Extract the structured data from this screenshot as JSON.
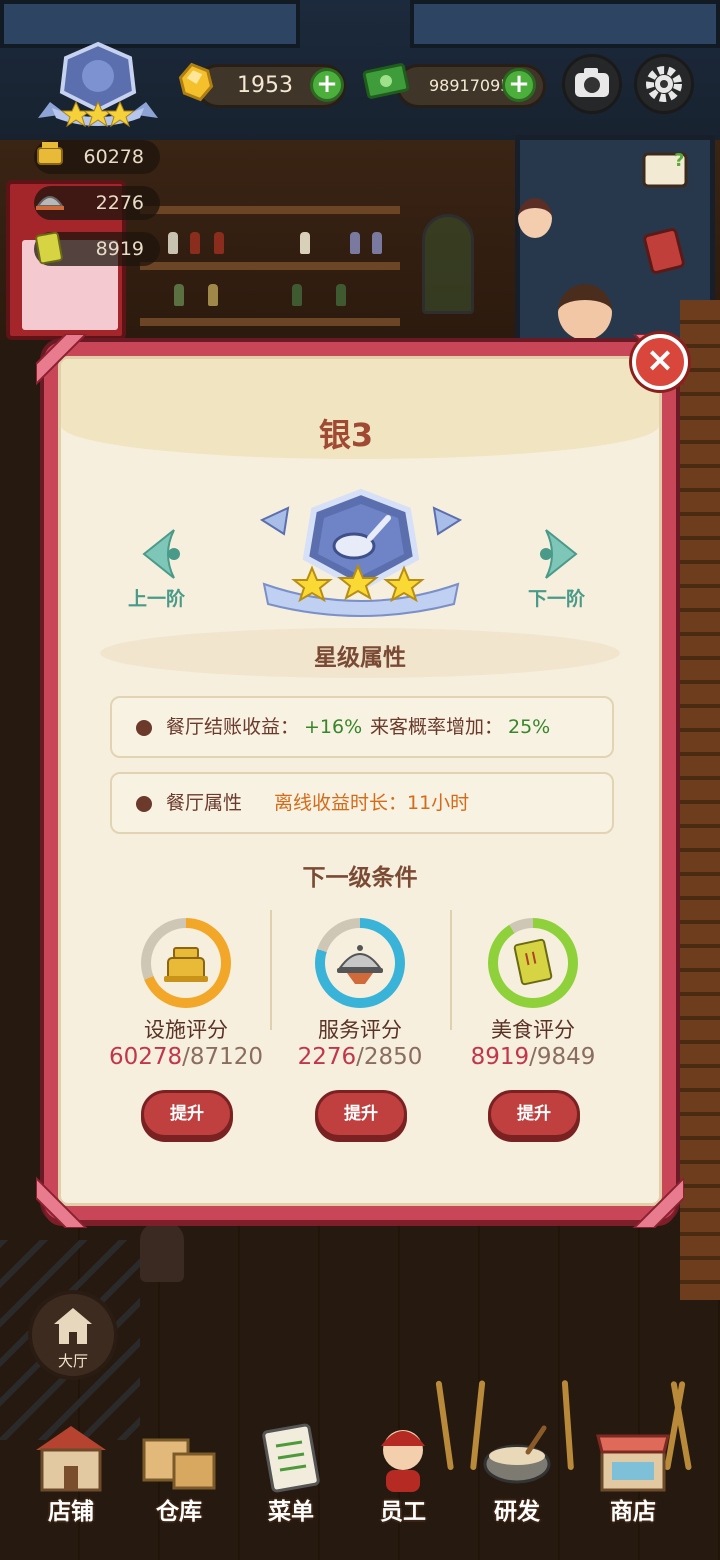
{
  "hud": {
    "gems": "1953",
    "cash": "98917095",
    "stats": {
      "facility": "60278",
      "service": "2276",
      "food": "8919"
    }
  },
  "modal": {
    "title": "银3",
    "prev_label": "上一阶",
    "next_label": "下一阶",
    "star_section_title": "星级属性",
    "attributes": {
      "row1_label": "餐厅结账收益：",
      "row1_value": "+16%",
      "row1_label2": "来客概率增加：",
      "row1_value2": "25%",
      "row2_label": "餐厅属性",
      "row2_value": "离线收益时长：11小时"
    },
    "next_level_title": "下一级条件",
    "conditions": [
      {
        "label": "设施评分",
        "current": "60278",
        "target": "/87120",
        "button": "提升",
        "ring_color": "#f2a728",
        "progress": 0.69
      },
      {
        "label": "服务评分",
        "current": "2276",
        "target": "/2850",
        "button": "提升",
        "ring_color": "#3ab3d9",
        "progress": 0.8
      },
      {
        "label": "美食评分",
        "current": "8919",
        "target": "/9849",
        "button": "提升",
        "ring_color": "#8fd13a",
        "progress": 0.91
      }
    ],
    "stars": 3
  },
  "bottom_nav": {
    "hall": "大厅",
    "items": [
      "店铺",
      "仓库",
      "菜单",
      "员工",
      "研发",
      "商店"
    ]
  },
  "colors": {
    "frame": "#c94658",
    "panel": "#f6efdd",
    "title": "#a14a33",
    "value_green": "#38862a",
    "value_orange": "#d46b1a",
    "progress_red": "#c2354a"
  }
}
